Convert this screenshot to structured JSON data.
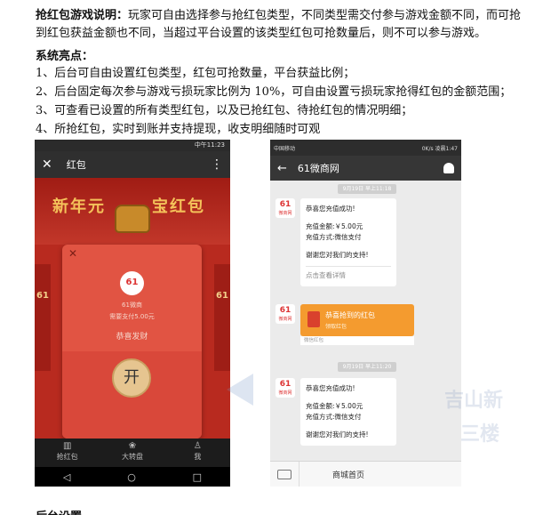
{
  "intro": {
    "label": "抢红包游戏说明：",
    "text": "玩家可自由选择参与抢红包类型，不同类型需交付参与游戏金额不同，而可抢到红包获益金额也不同，当超过平台设置的该类型红包可抢数量后，则不可以参与游戏。"
  },
  "features": {
    "title": "系统亮点：",
    "items": [
      "1、后台可自由设置红包类型，红包可抢数量，平台获益比例；",
      "2、后台固定每次参与游戏亏损玩家比例为 10%，可自由设置亏损玩家抢得红包的金额范围；",
      "3、可查看已设置的所有类型红包，以及已抢红包、待抢红包的情况明细；",
      "4、所抢红包，实时到账并支持提现，收支明细随时可观"
    ]
  },
  "phone1": {
    "status_time": "中午11:23",
    "title": "红包",
    "close_glyph": "✕",
    "more_glyph": "⋮",
    "banner_left": "新年元",
    "banner_right": "宝红包",
    "side_number": "61",
    "card": {
      "close_glyph": "✕",
      "logo": "61",
      "name": "61微商",
      "pay": "需要支付5.00元",
      "wish": "恭喜发财",
      "open": "开"
    },
    "tabs": [
      {
        "icon": "▥",
        "label": "抢红包"
      },
      {
        "icon": "❀",
        "label": "大转盘"
      },
      {
        "icon": "♙",
        "label": "我"
      }
    ],
    "nav": [
      "◁",
      "○",
      "□"
    ]
  },
  "phone2": {
    "status_left": "中国移动",
    "status_right": "0K/s 凌晨1:47",
    "title": "61微商网",
    "time1": "9月19日 早上11:18",
    "time2": "9月19日 早上11:20",
    "avatar_text": "61",
    "avatar_sub": "微商网",
    "msg1": {
      "line1": "恭喜您充值成功!",
      "line2": "充值金额:￥5.00元",
      "line3": "充值方式:微信支付",
      "line4": "谢谢您对我们的支持!",
      "link": "点击查看详情"
    },
    "hongbao": {
      "title": "恭喜抢到的红包",
      "sub": "领取红包",
      "foot": "微信红包"
    },
    "msg2": {
      "line1": "恭喜您充值成功!",
      "line2": "充值金额:￥5.00元",
      "line3": "充值方式:微信支付",
      "line4": "谢谢您对我们的支持!"
    },
    "footer_menu": "商城首页"
  },
  "watermark": {
    "line1": "吉山新",
    "line2": "三楼"
  },
  "next_section": "后台设置"
}
